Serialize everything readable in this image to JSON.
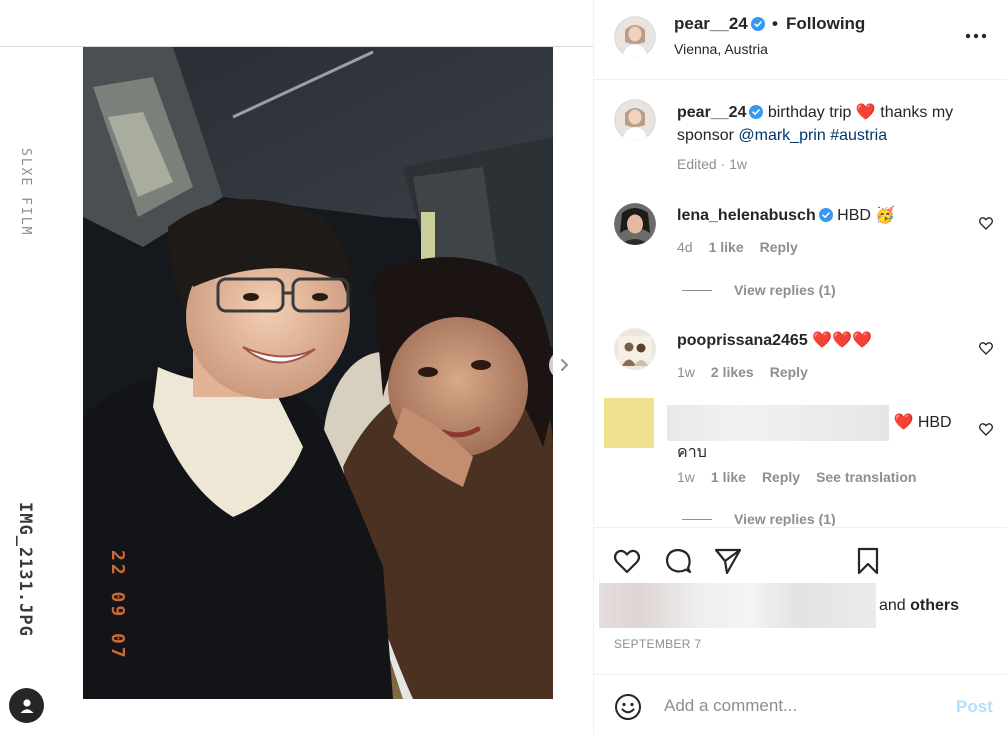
{
  "media": {
    "film_brand": "SLXE FILM",
    "film_filename": "IMG_2131.JPG",
    "date_stamp": "22 09 07",
    "next_icon": "chevron-right-icon",
    "profile_icon": "user-silhouette-icon"
  },
  "header": {
    "username": "pear__24",
    "separator": "•",
    "follow_status": "Following",
    "location": "Vienna, Austria",
    "more_icon": "more-options-icon"
  },
  "caption": {
    "username": "pear__24",
    "text_before": "birthday trip",
    "emoji": "❤️",
    "text_after": "thanks my sponsor",
    "mention": "@mark_prin",
    "hashtag": "#austria",
    "meta": "Edited · 1w"
  },
  "comments": [
    {
      "username": "lena_helenabusch",
      "verified": true,
      "text": "HBD",
      "emoji": "🥳",
      "time": "4d",
      "likes": "1 like",
      "reply": "Reply",
      "view_replies": "View replies (1)"
    },
    {
      "username": "pooprissana2465",
      "verified": false,
      "text": "",
      "emoji": "❤️❤️❤️",
      "time": "1w",
      "likes": "2 likes",
      "reply": "Reply"
    },
    {
      "username": "",
      "verified": false,
      "text": "HBD",
      "text_line2": "คาบ",
      "emoji": "❤️",
      "time": "1w",
      "likes": "1 like",
      "reply": "Reply",
      "translate": "See translation",
      "view_replies": "View replies (1)"
    }
  ],
  "actions": {
    "like_icon": "heart-icon",
    "comment_icon": "comment-bubble-icon",
    "share_icon": "paper-plane-icon",
    "save_icon": "bookmark-icon",
    "likes_suffix_pre": "and",
    "likes_suffix_bold": "others",
    "post_date": "SEPTEMBER 7"
  },
  "composer": {
    "emoji_icon": "smiley-icon",
    "placeholder": "Add a comment...",
    "post_label": "Post"
  },
  "colors": {
    "verified_blue": "#3897f0",
    "heart_red": "#e0243b",
    "link_blue": "#00376b",
    "muted_gray": "#8e8e8e",
    "post_button_disabled": "#b2dffc",
    "date_stamp_orange": "#e0733a"
  }
}
